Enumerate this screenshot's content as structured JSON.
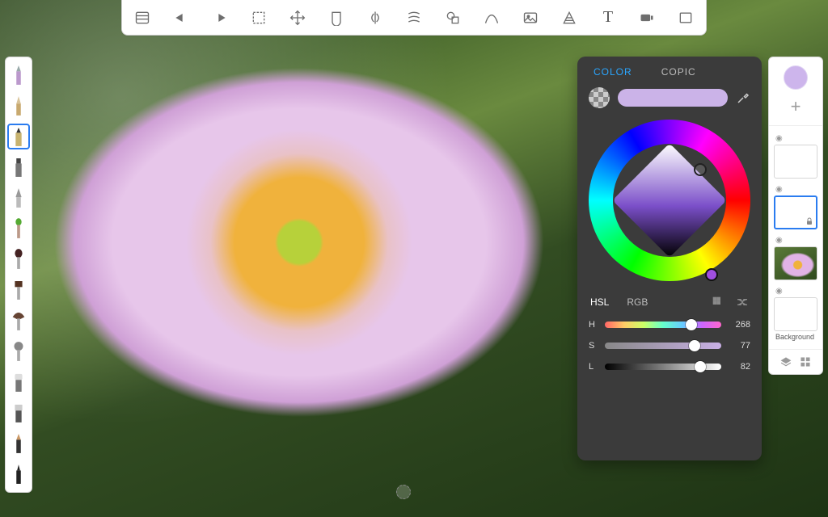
{
  "toolbar": {
    "items": [
      {
        "name": "layers-list-icon"
      },
      {
        "name": "undo-icon"
      },
      {
        "name": "redo-icon"
      },
      {
        "name": "selection-icon"
      },
      {
        "name": "transform-icon"
      },
      {
        "name": "fill-icon"
      },
      {
        "name": "symmetry-x-icon"
      },
      {
        "name": "symmetry-y-icon"
      },
      {
        "name": "shapes-icon"
      },
      {
        "name": "curve-icon"
      },
      {
        "name": "image-icon"
      },
      {
        "name": "perspective-icon"
      },
      {
        "name": "text-icon",
        "glyph": "T"
      },
      {
        "name": "timelapse-icon"
      },
      {
        "name": "fullscreen-icon"
      }
    ]
  },
  "brushes": {
    "items": [
      {
        "name": "brush-pencil"
      },
      {
        "name": "brush-pen"
      },
      {
        "name": "brush-marker",
        "selected": true
      },
      {
        "name": "brush-chisel"
      },
      {
        "name": "brush-airbrush"
      },
      {
        "name": "brush-paint"
      },
      {
        "name": "brush-round"
      },
      {
        "name": "brush-flat"
      },
      {
        "name": "brush-fan"
      },
      {
        "name": "brush-smudge"
      },
      {
        "name": "brush-eraser-soft"
      },
      {
        "name": "brush-eraser-hard"
      },
      {
        "name": "brush-synthetic"
      },
      {
        "name": "brush-inking"
      }
    ]
  },
  "colorPanel": {
    "tabs": {
      "color": "COLOR",
      "copic": "COPIC",
      "active": "color"
    },
    "swatch": "#CBB3E8",
    "modes": {
      "hsl": "HSL",
      "rgb": "RGB",
      "active": "hsl"
    },
    "hsl": {
      "h": {
        "label": "H",
        "value": 268,
        "pct": 74
      },
      "s": {
        "label": "S",
        "value": 77,
        "pct": 77
      },
      "l": {
        "label": "L",
        "value": 82,
        "pct": 82
      }
    }
  },
  "layers": {
    "currentColor": "#CDB5EC",
    "items": [
      {
        "name": "layer-3",
        "thumb": "blank"
      },
      {
        "name": "layer-2",
        "thumb": "blank",
        "selected": true,
        "locked": true
      },
      {
        "name": "layer-1",
        "thumb": "flower"
      },
      {
        "name": "layer-bg",
        "thumb": "blank",
        "label": "Background"
      }
    ]
  }
}
